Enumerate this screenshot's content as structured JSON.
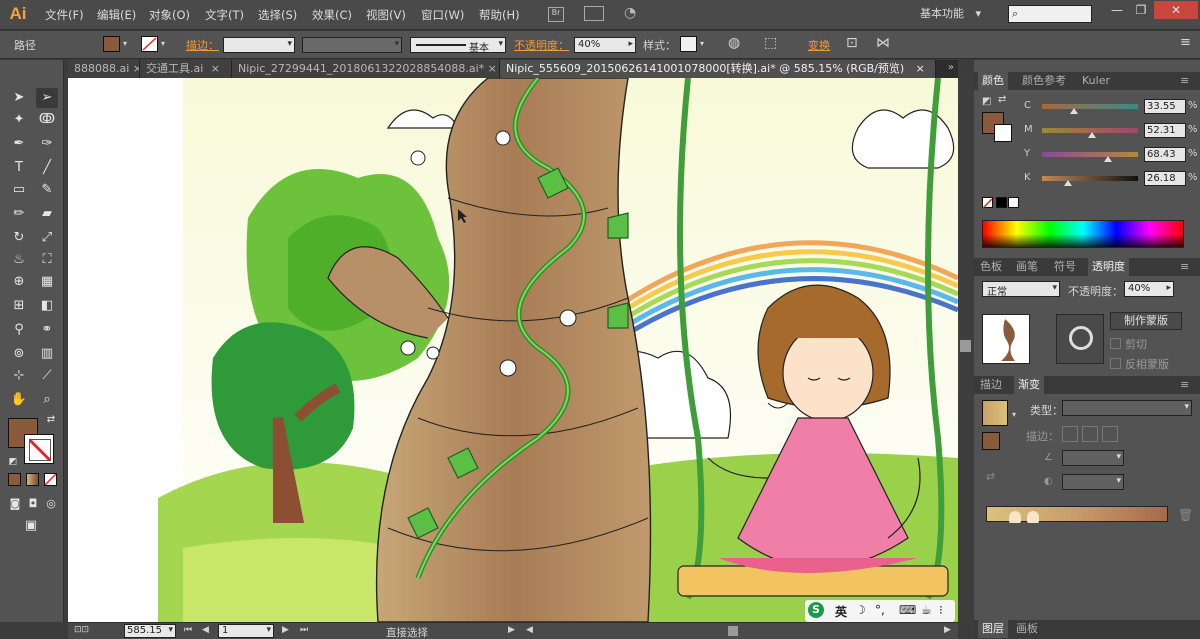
{
  "app": {
    "logo": "Ai",
    "workspace": "基本功能",
    "workspace_arrow": "▾"
  },
  "menu": [
    "文件(F)",
    "编辑(E)",
    "对象(O)",
    "文字(T)",
    "选择(S)",
    "效果(C)",
    "视图(V)",
    "窗口(W)",
    "帮助(H)"
  ],
  "window_buttons": [
    "—",
    "❐",
    "✕"
  ],
  "control_bar": {
    "selection_label": "路径",
    "stroke_label": "描边：",
    "stroke_profile": "基本",
    "opacity_label": "不透明度：",
    "opacity_value": "40%",
    "style_label": "样式：",
    "transform_label": "变换",
    "fill_color": "#8b5a3c"
  },
  "tabs": [
    {
      "label": "888088.ai",
      "close": "×"
    },
    {
      "label": "交通工具.ai",
      "close": "×"
    },
    {
      "label": "Nipic_27299441_20180613220288540​88.ai*",
      "close": "×"
    },
    {
      "label": "Nipic_555609_20150626141001078000[转换].ai* @ 585.15% (RGB/预览)",
      "close": "×"
    }
  ],
  "status": {
    "zoom": "585.15",
    "artboard": "1",
    "tool": "直接选择"
  },
  "ime": {
    "label": "英",
    "logo": "S"
  },
  "color_panel": {
    "tabs": [
      "颜色",
      "颜色参考",
      "Kuler"
    ],
    "channels": [
      {
        "name": "C",
        "value": "33.55"
      },
      {
        "name": "M",
        "value": "52.31"
      },
      {
        "name": "Y",
        "value": "68.43"
      },
      {
        "name": "K",
        "value": "26.18"
      }
    ],
    "percent": "%"
  },
  "transparency_panel": {
    "tabs": [
      "色板",
      "画笔",
      "符号",
      "透明度"
    ],
    "blend_mode": "正常",
    "opacity_label": "不透明度：",
    "opacity_value": "40%",
    "make_mask_button": "制作蒙版",
    "clip_label": "剪切",
    "invert_label": "反相蒙版"
  },
  "gradient_panel": {
    "tabs": [
      "描边",
      "渐变"
    ],
    "type_label": "类型：",
    "stroke_label": "描边："
  },
  "bottom_tabs": [
    "图层",
    "画板"
  ]
}
